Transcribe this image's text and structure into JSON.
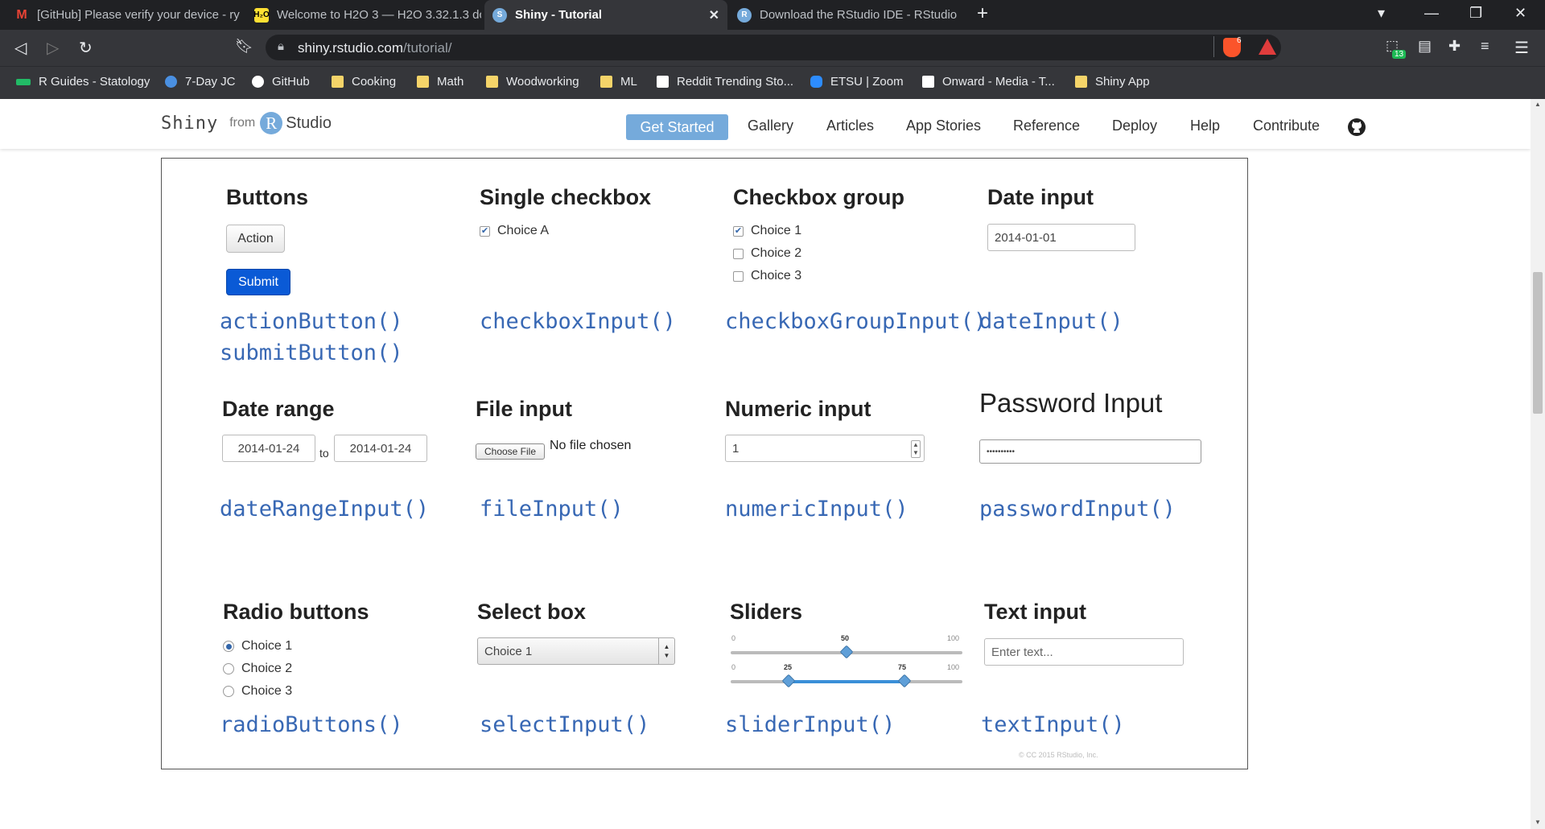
{
  "tabs": [
    {
      "title": "[GitHub] Please verify your device - ry",
      "icon": "gmail-icon"
    },
    {
      "title": "Welcome to H2O 3 — H2O 3.32.1.3 dc",
      "icon": "h2o-icon"
    },
    {
      "title": "Shiny - Tutorial",
      "icon": "shiny-icon"
    },
    {
      "title": "Download the RStudio IDE - RStudio",
      "icon": "rstudio-icon"
    }
  ],
  "address": {
    "host": "shiny.rstudio.com",
    "path": "/tutorial/",
    "ext_badge": "13",
    "brave_badge": "6"
  },
  "bookmarks": [
    "R Guides - Statology",
    "7-Day JC",
    "GitHub",
    "Cooking",
    "Math",
    "Woodworking",
    "ML",
    "Reddit Trending Sto...",
    "ETSU | Zoom",
    "Onward - Media - T...",
    "Shiny App"
  ],
  "site": {
    "brand": {
      "shiny": "Shiny",
      "from": "from",
      "r": "R",
      "studio": "Studio"
    },
    "menu": [
      "Get Started",
      "Gallery",
      "Articles",
      "App Stories",
      "Reference",
      "Deploy",
      "Help",
      "Contribute"
    ]
  },
  "widgets": {
    "buttons": {
      "title": "Buttons",
      "action": "Action",
      "submit": "Submit",
      "fn1": "actionButton()",
      "fn2": "submitButton()"
    },
    "single_checkbox": {
      "title": "Single checkbox",
      "label": "Choice A",
      "fn": "checkboxInput()"
    },
    "checkbox_group": {
      "title": "Checkbox group",
      "choices": [
        "Choice 1",
        "Choice 2",
        "Choice 3"
      ],
      "fn": "checkboxGroupInput()"
    },
    "date_input": {
      "title": "Date input",
      "value": "2014-01-01",
      "fn": "dateInput()"
    },
    "date_range": {
      "title": "Date range",
      "start": "2014-01-24",
      "end": "2014-01-24",
      "sep": "to",
      "fn": "dateRangeInput()"
    },
    "file_input": {
      "title": "File input",
      "button": "Choose File",
      "status": "No file chosen",
      "fn": "fileInput()"
    },
    "numeric_input": {
      "title": "Numeric input",
      "value": "1",
      "fn": "numericInput()"
    },
    "password_input": {
      "title": "Password Input",
      "value": "••••••••••",
      "fn": "passwordInput()"
    },
    "radio": {
      "title": "Radio buttons",
      "choices": [
        "Choice 1",
        "Choice 2",
        "Choice 3"
      ],
      "fn": "radioButtons()"
    },
    "select": {
      "title": "Select box",
      "value": "Choice 1",
      "fn": "selectInput()"
    },
    "sliders": {
      "title": "Sliders",
      "min": "0",
      "max": "100",
      "single": "50",
      "range_lo": "25",
      "range_hi": "75",
      "fn": "sliderInput()"
    },
    "text_input": {
      "title": "Text input",
      "placeholder": "Enter text...",
      "fn": "textInput()"
    }
  },
  "footer": "© CC 2015 RStudio, Inc."
}
